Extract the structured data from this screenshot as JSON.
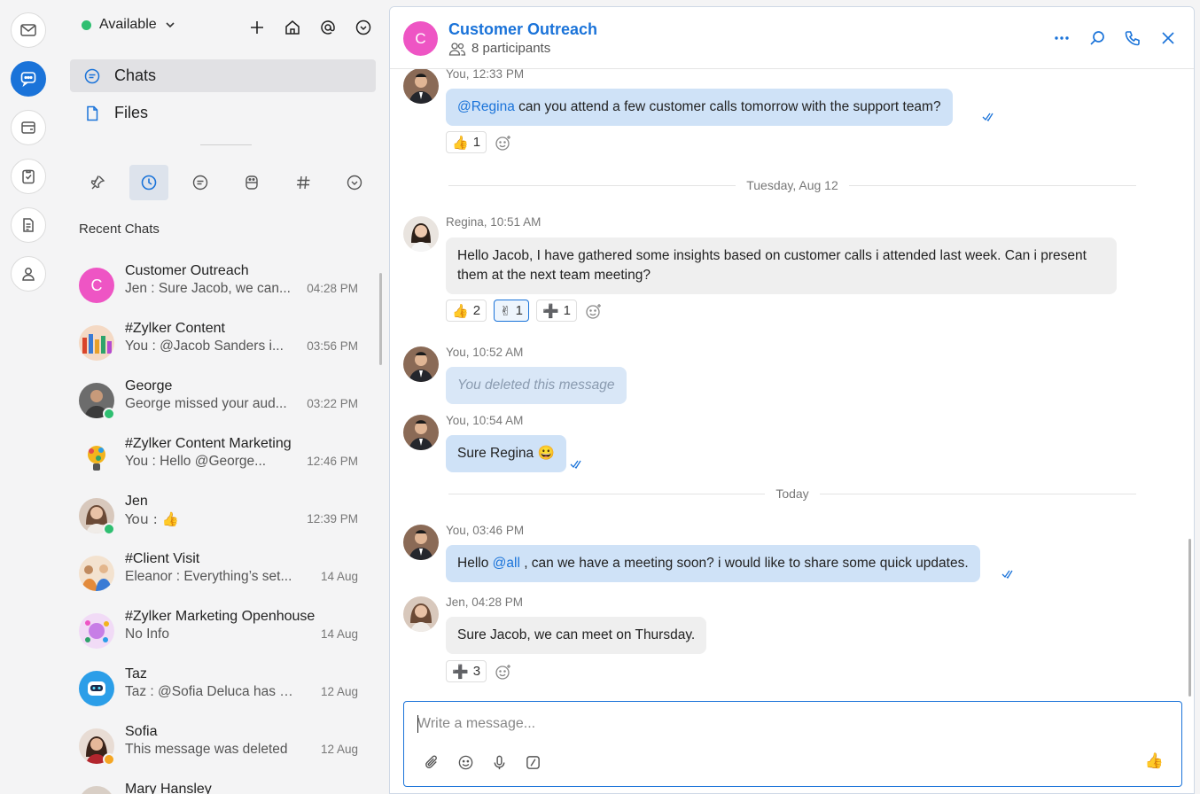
{
  "status": {
    "label": "Available",
    "color": "#2fbf71"
  },
  "nav": [
    {
      "label": "Chats",
      "icon": "chat-bubble-icon"
    },
    {
      "label": "Files",
      "icon": "file-icon"
    }
  ],
  "recent_title": "Recent Chats",
  "chats": [
    {
      "name": "Customer Outreach",
      "preview": "Jen : Sure Jacob, we can...",
      "time": "04:28 PM",
      "initial": "C",
      "avatar_color": "#ee55c4"
    },
    {
      "name": "#Zylker Content",
      "preview": "You : @Jacob Sanders  i...",
      "time": "03:56 PM",
      "avatar_color": "#d96a3a"
    },
    {
      "name": "George",
      "preview": "George missed your aud...",
      "time": "03:22 PM",
      "avatar_color": "#5b5047",
      "presence": "online"
    },
    {
      "name": "#Zylker Content Marketing",
      "preview": "You : Hello @George...",
      "time": "12:46 PM",
      "avatar_color": "#f2b41c"
    },
    {
      "name": "Jen",
      "preview": "You : 👍",
      "time": "12:39 PM",
      "avatar_color": "#b9876a",
      "presence": "online"
    },
    {
      "name": "#Client Visit",
      "preview": "Eleanor : Everything’s set...",
      "time": "14 Aug",
      "avatar_color": "#e38b3c"
    },
    {
      "name": "#Zylker Marketing Openhouse",
      "preview": "No Info",
      "time": "14 Aug",
      "avatar_color": "#c77ee6"
    },
    {
      "name": "Taz",
      "preview": "Taz : @Sofia Deluca has m...",
      "time": "12 Aug",
      "avatar_color": "#2b9ee8"
    },
    {
      "name": "Sofia",
      "preview": "This message was deleted",
      "time": "12 Aug",
      "avatar_color": "#a34a4a",
      "presence": "away"
    },
    {
      "name": "Mary Hansley",
      "preview": "",
      "time": "",
      "avatar_color": "#9a7d6a"
    }
  ],
  "conversation": {
    "title": "Customer Outreach",
    "initial": "C",
    "participants": "8 participants",
    "messages": [
      {
        "meta": "You, 12:33 PM",
        "mention": "@Regina",
        "text": " can you attend a few customer calls tomorrow with the support team?",
        "reactions": [
          {
            "emoji": "👍",
            "count": "1"
          }
        ]
      },
      {
        "separator": "Tuesday, Aug 12"
      },
      {
        "meta": "Regina, 10:51 AM",
        "text": "Hello Jacob, I have gathered some insights based on customer calls i attended last week. Can i present them at the next team meeting?",
        "reactions": [
          {
            "emoji": "👍",
            "count": "2"
          },
          {
            "emoji": "✌",
            "count": "1"
          },
          {
            "emoji": "➕",
            "count": "1"
          }
        ]
      },
      {
        "meta": "You, 10:52 AM",
        "text": "You deleted this message"
      },
      {
        "meta": "You, 10:54 AM",
        "text": "Sure Regina 😀"
      },
      {
        "separator": "Today"
      },
      {
        "meta": "You, 03:46 PM",
        "prefix": "Hello ",
        "mention": "@all",
        "text": " , can we have a meeting soon? i would like to share some quick updates."
      },
      {
        "meta": "Jen, 04:28 PM",
        "text": "Sure Jacob, we can meet on Thursday.",
        "reactions": [
          {
            "emoji": "➕",
            "count": "3"
          }
        ]
      }
    ]
  },
  "composer": {
    "placeholder": "Write a message...",
    "send_icon": "👍"
  },
  "colors": {
    "accent": "#1a73d9",
    "own_bubble": "#cfe2f7",
    "other_bubble": "#efefef"
  }
}
